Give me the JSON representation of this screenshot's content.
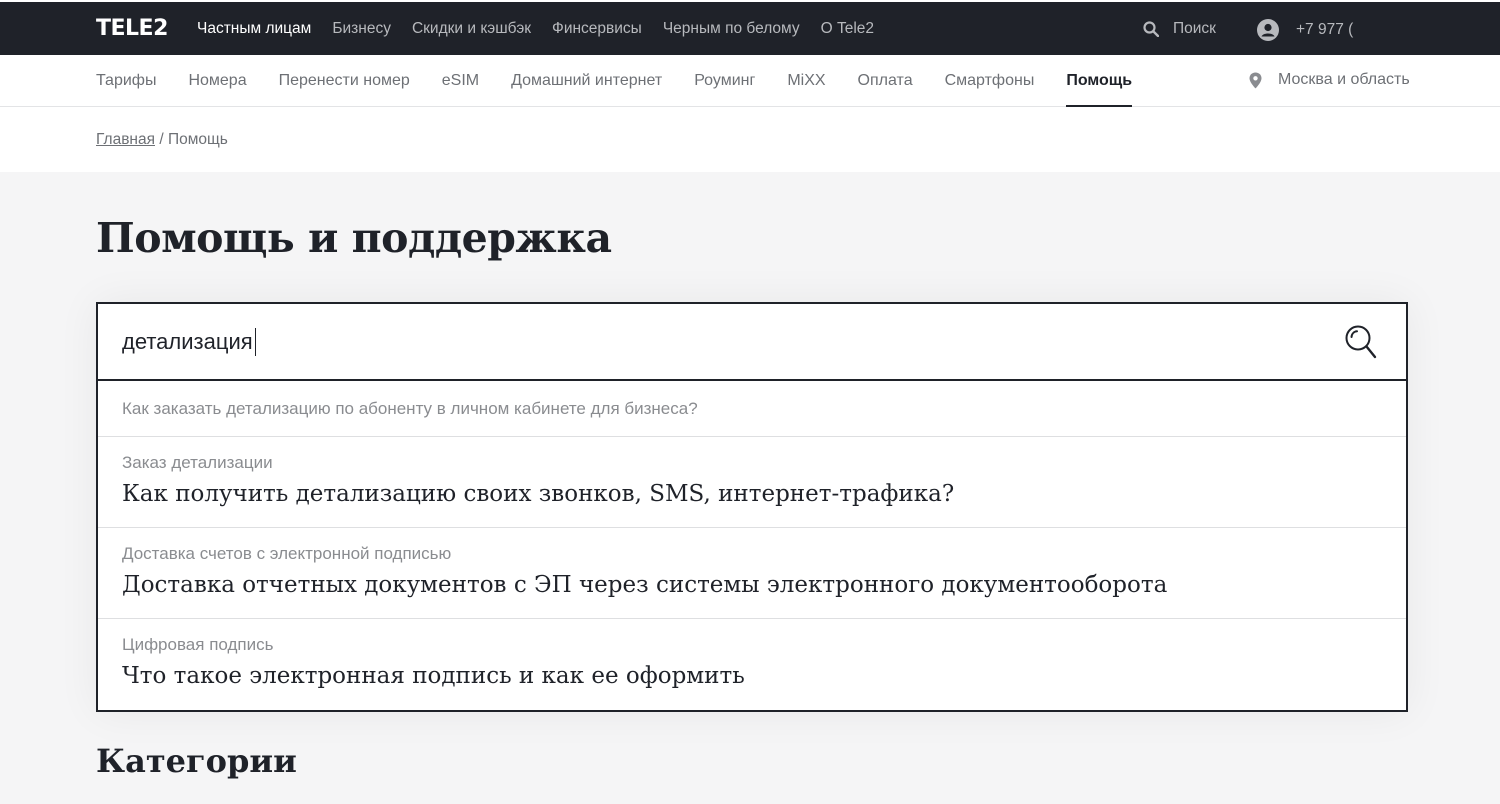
{
  "header": {
    "logo": "TELE2",
    "nav": [
      {
        "label": "Частным лицам",
        "active": true
      },
      {
        "label": "Бизнесу",
        "active": false
      },
      {
        "label": "Скидки и кэшбэк",
        "active": false
      },
      {
        "label": "Финсервисы",
        "active": false
      },
      {
        "label": "Черным по белому",
        "active": false
      },
      {
        "label": "О Tele2",
        "active": false
      }
    ],
    "search_label": "Поиск",
    "account_phone": "+7 977 ("
  },
  "subnav": {
    "items": [
      {
        "label": "Тарифы"
      },
      {
        "label": "Номера"
      },
      {
        "label": "Перенести номер"
      },
      {
        "label": "eSIM"
      },
      {
        "label": "Домашний интернет"
      },
      {
        "label": "Роуминг"
      },
      {
        "label": "MiXX"
      },
      {
        "label": "Оплата"
      },
      {
        "label": "Смартфоны"
      },
      {
        "label": "Помощь",
        "active": true
      }
    ],
    "region": "Москва и область"
  },
  "breadcrumb": {
    "home": "Главная",
    "separator": "/",
    "current": "Помощь"
  },
  "page_title": "Помощь и поддержка",
  "search": {
    "value": "детализация"
  },
  "suggestions": {
    "plain": "Как заказать детализацию по абоненту в личном кабинете для бизнеса?",
    "items": [
      {
        "category": "Заказ детализации",
        "title": "Как получить детализацию своих звонков, SMS, интернет-трафика?"
      },
      {
        "category": "Доставка счетов с электронной подписью",
        "title": "Доставка отчетных документов с ЭП через системы электронного документооборота"
      },
      {
        "category": "Цифровая подпись",
        "title": "Что такое электронная подпись и как ее оформить"
      }
    ]
  },
  "categories_title": "Категории",
  "colors": {
    "header_bg": "#1f2229",
    "page_bg": "#f5f5f6",
    "text": "#1f2229",
    "muted": "#8a8c90"
  }
}
